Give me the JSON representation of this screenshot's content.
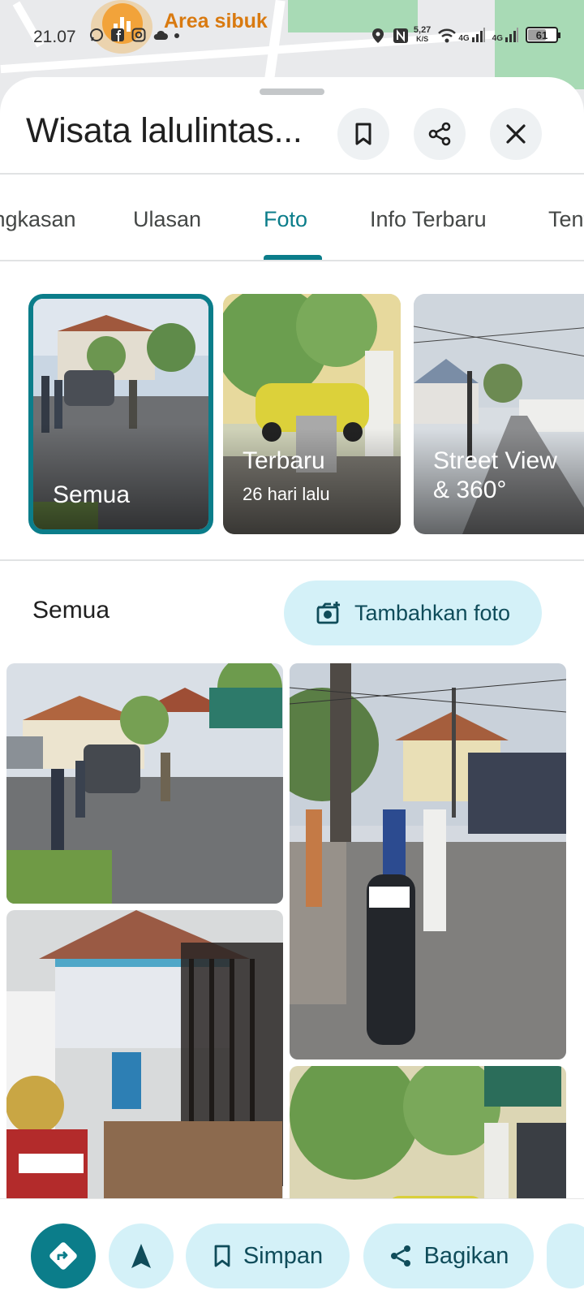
{
  "status_bar": {
    "time": "21.07",
    "net_speed_top": "5,27",
    "net_speed_unit": "K/S",
    "signal_label_1": "4G",
    "signal_label_2": "4G",
    "battery": "61"
  },
  "map": {
    "busy_area_label": "Area sibuk"
  },
  "place": {
    "title": "Wisata lalulintas..."
  },
  "tabs": [
    {
      "label": "Ringkasan"
    },
    {
      "label": "Ulasan"
    },
    {
      "label": "Foto",
      "active": true
    },
    {
      "label": "Info Terbaru"
    },
    {
      "label": "Tentang"
    }
  ],
  "categories": [
    {
      "title": "Semua",
      "subtitle": ""
    },
    {
      "title": "Terbaru",
      "subtitle": "26 hari lalu"
    },
    {
      "title": "Street View\n& 360°",
      "subtitle": ""
    }
  ],
  "section": {
    "title": "Semua",
    "add_photo_label": "Tambahkan foto"
  },
  "actions": {
    "save_label": "Simpan",
    "share_label": "Bagikan"
  },
  "colors": {
    "accent": "#0b7d8a",
    "pill_bg": "#d4f1f8",
    "pill_text": "#0f4c5a"
  },
  "icons": [
    "busy-chart-icon",
    "whatsapp-icon",
    "facebook-icon",
    "instagram-icon",
    "cloud-icon",
    "location-icon",
    "nfc-icon",
    "wifi-icon",
    "signal-icon",
    "battery-icon",
    "bookmark-icon",
    "share-icon",
    "close-icon",
    "add-photo-icon",
    "directions-icon",
    "navigate-icon"
  ]
}
